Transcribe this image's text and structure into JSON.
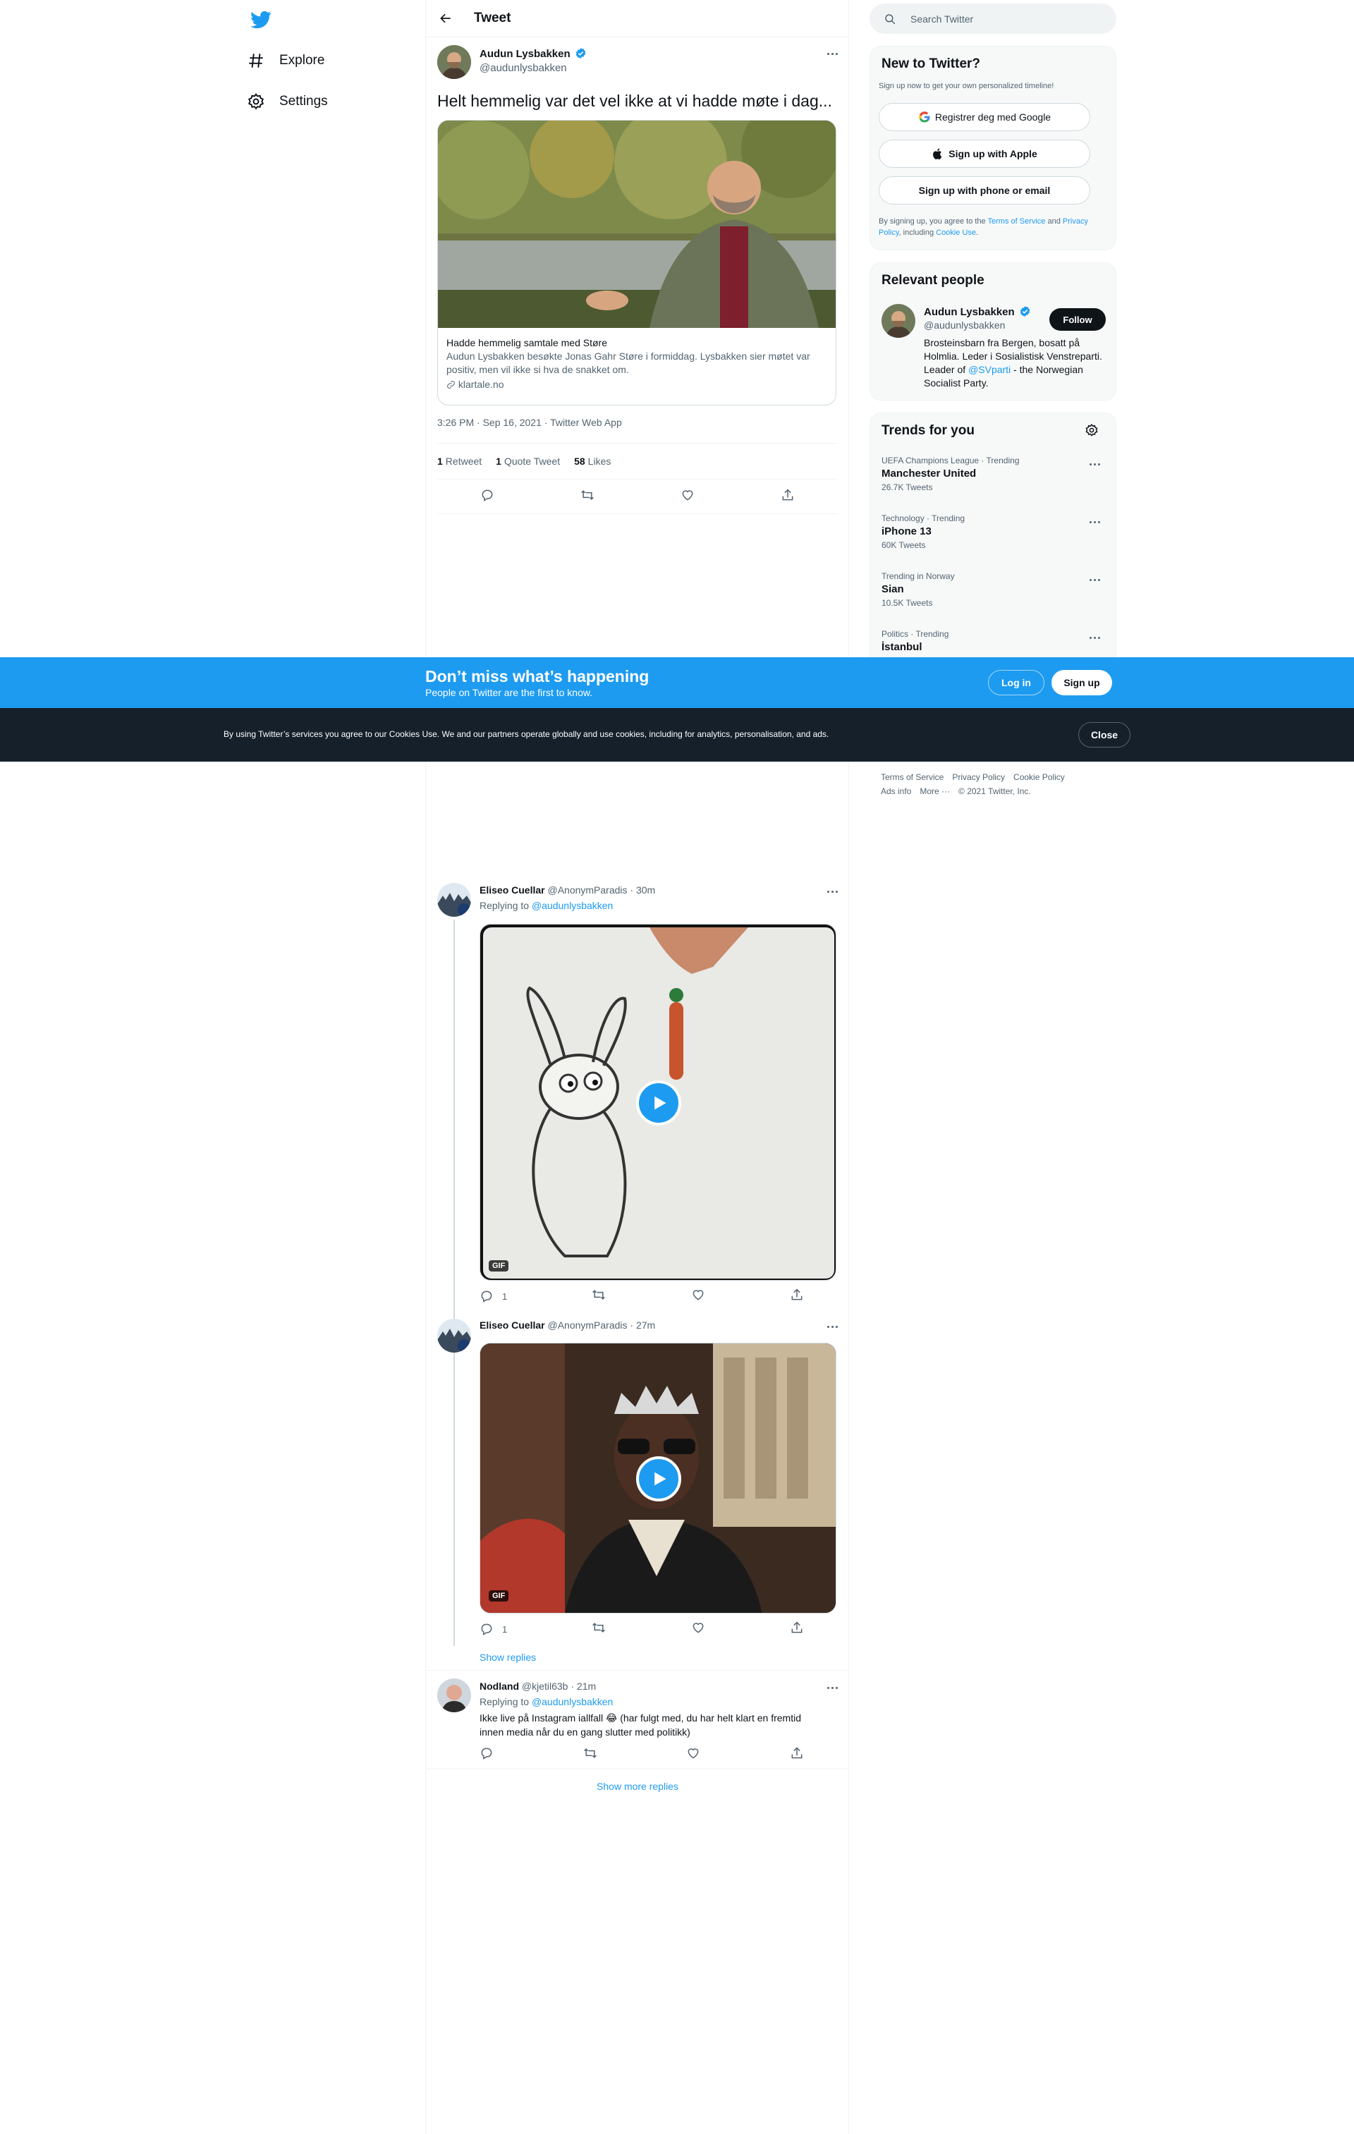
{
  "nav": {
    "logo": "twitter-bird-icon",
    "items": [
      {
        "label": "Explore",
        "icon": "hashtag-icon"
      },
      {
        "label": "Settings",
        "icon": "gear-icon"
      }
    ]
  },
  "header": {
    "title": "Tweet"
  },
  "tweet": {
    "author_name": "Audun Lysbakken",
    "author_handle": "@audunlysbakken",
    "text": "Helt hemmelig var det vel ikke at vi hadde møte i dag...",
    "card": {
      "title": "Hadde hemmelig samtale med Støre",
      "description": "Audun Lysbakken besøkte Jonas Gahr Støre i formiddag. Lysbakken sier møtet var positiv, men vil ikke si hva de snakket om.",
      "domain": "klartale.no"
    },
    "timestamp": "3:26 PM · Sep 16, 2021 · Twitter Web App",
    "stats": {
      "retweets_num": "1",
      "retweets_label": "Retweet",
      "quotes_num": "1",
      "quotes_label": "Quote Tweet",
      "likes_num": "58",
      "likes_label": "Likes"
    }
  },
  "right": {
    "search_placeholder": "Search Twitter",
    "new_to": {
      "title": "New to Twitter?",
      "subtitle": "Sign up now to get your own personalized timeline!",
      "google": "Registrer deg med Google",
      "apple": "Sign up with Apple",
      "phone": "Sign up with phone or email",
      "legal_1": "By signing up, you agree to the ",
      "terms": "Terms of Service",
      "legal_2": " and ",
      "privacy": "Privacy Policy",
      "legal_3": ", including ",
      "cookie": "Cookie Use",
      "legal_4": "."
    },
    "relevant": {
      "title": "Relevant people",
      "name": "Audun Lysbakken",
      "handle": "@audunlysbakken",
      "follow": "Follow",
      "bio_1": "Brosteinsbarn fra Bergen, bosatt på Holmlia. Leder i Sosialistisk Venstreparti. Leader of ",
      "bio_link": "@SVparti",
      "bio_2": " - the Norwegian Socialist Party."
    },
    "trends": {
      "title": "Trends for you",
      "items": [
        {
          "meta": "UEFA Champions League · Trending",
          "name": "Manchester United",
          "count": "26.7K Tweets"
        },
        {
          "meta": "Technology · Trending",
          "name": "iPhone 13",
          "count": "60K Tweets"
        },
        {
          "meta": "Trending in Norway",
          "name": "Sian",
          "count": "10.5K Tweets"
        },
        {
          "meta": "Politics · Trending",
          "name": "İstanbul",
          "count": ""
        }
      ]
    },
    "footer": [
      "Terms of Service",
      "Privacy Policy",
      "Cookie Policy",
      "Ads info",
      "More ···",
      "© 2021 Twitter, Inc."
    ]
  },
  "signup_banner": {
    "title": "Don’t miss what’s happening",
    "subtitle": "People on Twitter are the first to know.",
    "login": "Log in",
    "signup": "Sign up"
  },
  "cookie_banner": {
    "text": "By using Twitter’s services you agree to our Cookies Use. We and our partners operate globally and use cookies, including for analytics, personalisation, and ads.",
    "close": "Close"
  },
  "replies": [
    {
      "name": "Eliseo Cuellar",
      "handle": "@AnonymParadis",
      "time": "· 30m",
      "replying_prefix": "Replying to ",
      "replying_to": "@audunlysbakken",
      "gif_label": "GIF",
      "reply_count": "1"
    },
    {
      "name": "Eliseo Cuellar",
      "handle": "@AnonymParadis",
      "time": "· 27m",
      "gif_label": "GIF",
      "reply_count": "1",
      "show_replies": "Show replies"
    },
    {
      "name": "Nodland",
      "handle": "@kjetil63b",
      "time": "· 21m",
      "replying_prefix": "Replying to ",
      "replying_to": "@audunlysbakken",
      "text_1": "Ikke live på Instagram iallfall 😂 (har fulgt med, du har helt klart en fremtid",
      "text_2": "innen media når du en gang slutter med politikk)"
    }
  ],
  "show_more_replies": "Show more replies"
}
